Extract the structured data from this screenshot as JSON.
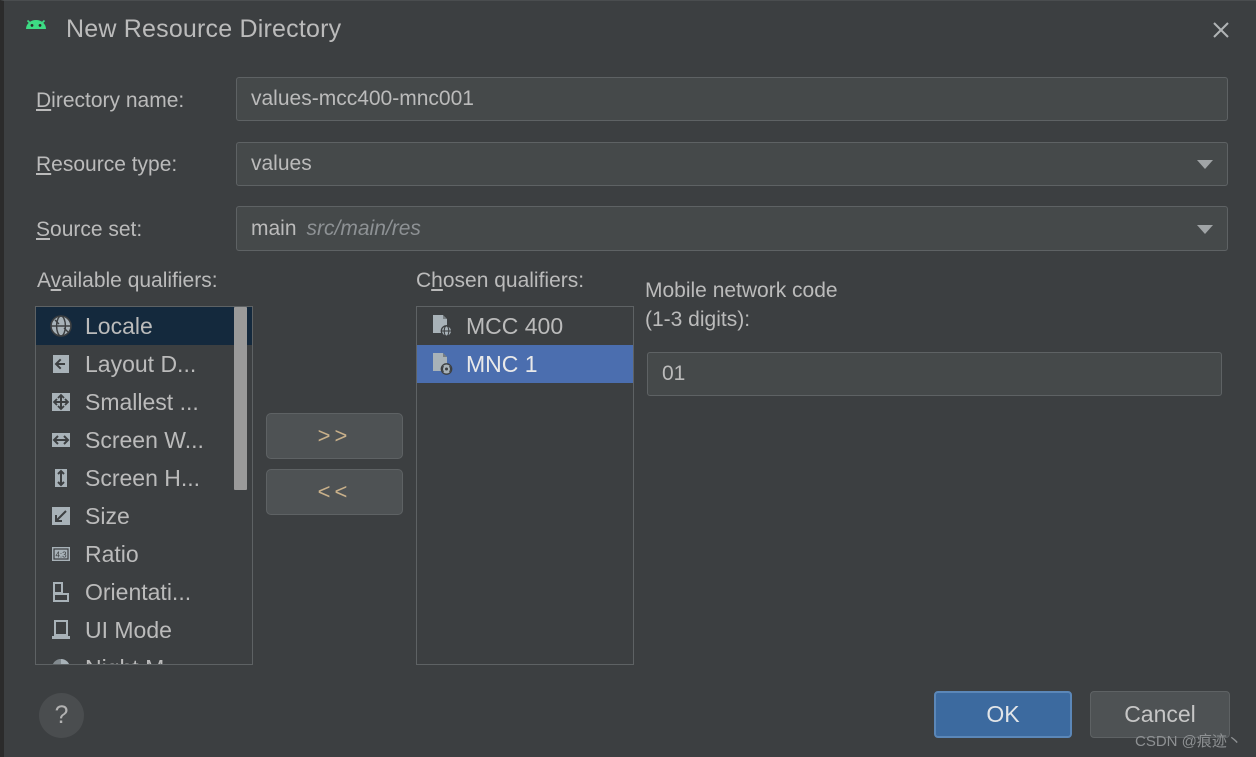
{
  "window": {
    "title": "New Resource Directory",
    "app_icon": "android-icon",
    "close_icon": "close-icon"
  },
  "form": {
    "directory_name": {
      "label_prefix": "",
      "label_mnemonic": "D",
      "label_suffix": "irectory name:",
      "value": "values-mcc400-mnc001"
    },
    "resource_type": {
      "label_mnemonic": "R",
      "label_suffix": "esource type:",
      "value": "values"
    },
    "source_set": {
      "label_mnemonic": "S",
      "label_suffix": "ource set:",
      "value": "main",
      "path": "src/main/res"
    }
  },
  "available": {
    "label_prefix": "A",
    "label_mnemonic": "v",
    "label_suffix": "ailable qualifiers:",
    "items": [
      {
        "label": "Locale",
        "icon": "globe-icon",
        "selected": true
      },
      {
        "label": "Layout D...",
        "icon": "arrow-left-icon",
        "selected": false
      },
      {
        "label": "Smallest ...",
        "icon": "arrows-four-way-icon",
        "selected": false
      },
      {
        "label": "Screen W...",
        "icon": "arrow-horizontal-icon",
        "selected": false
      },
      {
        "label": "Screen H...",
        "icon": "arrow-vertical-icon",
        "selected": false
      },
      {
        "label": "Size",
        "icon": "arrow-diagonal-icon",
        "selected": false
      },
      {
        "label": "Ratio",
        "icon": "ratio-icon",
        "selected": false
      },
      {
        "label": "Orientati...",
        "icon": "orientation-icon",
        "selected": false
      },
      {
        "label": "UI Mode",
        "icon": "ui-mode-icon",
        "selected": false
      },
      {
        "label": "Night M...",
        "icon": "night-mode-icon",
        "selected": false
      }
    ]
  },
  "transfer": {
    "add_label": ">>",
    "remove_label": "<<"
  },
  "chosen": {
    "label_prefix": "C",
    "label_mnemonic": "h",
    "label_suffix": "osen qualifiers:",
    "items": [
      {
        "label": "MCC 400",
        "icon": "file-globe-icon",
        "selected": false
      },
      {
        "label": "MNC 1",
        "icon": "file-signal-icon",
        "selected": true
      }
    ]
  },
  "detail": {
    "label": "Mobile network code\n(1-3 digits):",
    "value": "01"
  },
  "footer": {
    "help_label": "?",
    "help_icon": "question-mark-icon",
    "ok_label": "OK",
    "cancel_label": "Cancel"
  },
  "watermark": "CSDN @痕迹丶",
  "colors": {
    "background": "#3c3f41",
    "field_background": "#45494a",
    "selection_active": "#4b6eaf",
    "selection_inactive": "#14293d",
    "ok_button": "#3c6a9f",
    "text": "#bbbbbb",
    "android_green": "#3ddc84"
  }
}
